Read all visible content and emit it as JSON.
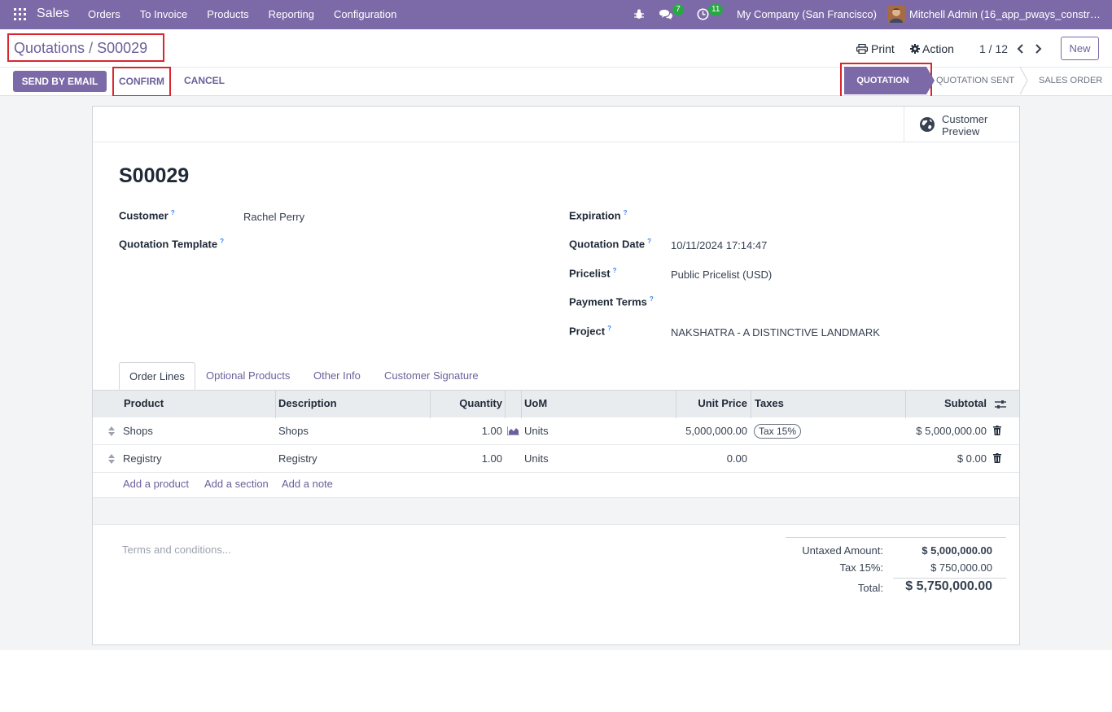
{
  "navbar": {
    "app_name": "Sales",
    "menu": [
      "Orders",
      "To Invoice",
      "Products",
      "Reporting",
      "Configuration"
    ],
    "messages_count": "7",
    "activities_count": "11",
    "company": "My Company (San Francisco)",
    "user": "Mitchell Admin (16_app_pways_construction)"
  },
  "breadcrumb": {
    "parent": "Quotations",
    "separator": "/",
    "current": "S00029"
  },
  "control": {
    "print_label": "Print",
    "action_label": "Action",
    "pager": "1 / 12",
    "new_label": "New"
  },
  "buttons": {
    "send_by_email": "SEND BY EMAIL",
    "confirm": "CONFIRM",
    "cancel": "CANCEL"
  },
  "status": {
    "stages": [
      "QUOTATION",
      "QUOTATION SENT",
      "SALES ORDER"
    ],
    "active": "QUOTATION"
  },
  "sheet": {
    "customer_preview_line1": "Customer",
    "customer_preview_line2": "Preview",
    "order_name": "S00029"
  },
  "fields": {
    "customer": {
      "label": "Customer",
      "value": "Rachel Perry"
    },
    "quotation_template": {
      "label": "Quotation Template",
      "value": ""
    },
    "expiration": {
      "label": "Expiration",
      "value": ""
    },
    "quotation_date": {
      "label": "Quotation Date",
      "value": "10/11/2024 17:14:47"
    },
    "pricelist": {
      "label": "Pricelist",
      "value": "Public Pricelist (USD)"
    },
    "payment_terms": {
      "label": "Payment Terms",
      "value": ""
    },
    "project": {
      "label": "Project",
      "value": "NAKSHATRA - A DISTINCTIVE LANDMARK"
    },
    "help_mark": "?"
  },
  "tabs": [
    "Order Lines",
    "Optional Products",
    "Other Info",
    "Customer Signature"
  ],
  "order_lines": {
    "columns": [
      "Product",
      "Description",
      "Quantity",
      "UoM",
      "Unit Price",
      "Taxes",
      "Subtotal"
    ],
    "rows": [
      {
        "product": "Shops",
        "description": "Shops",
        "quantity": "1.00",
        "uom": "Units",
        "unit_price": "5,000,000.00",
        "taxes": "Tax 15%",
        "subtotal": "$ 5,000,000.00"
      },
      {
        "product": "Registry",
        "description": "Registry",
        "quantity": "1.00",
        "uom": "Units",
        "unit_price": "0.00",
        "taxes": "",
        "subtotal": "$ 0.00"
      }
    ],
    "add_product": "Add a product",
    "add_section": "Add a section",
    "add_note": "Add a note"
  },
  "terms_placeholder": "Terms and conditions...",
  "totals": {
    "untaxed_label": "Untaxed Amount:",
    "untaxed_value": "$ 5,000,000.00",
    "tax_label": "Tax 15%:",
    "tax_value": "$ 750,000.00",
    "total_label": "Total:",
    "total_value": "$ 5,750,000.00"
  },
  "colors": {
    "brand": "#7c6aa8",
    "highlight": "#d9262f",
    "badge": "#28a745"
  }
}
